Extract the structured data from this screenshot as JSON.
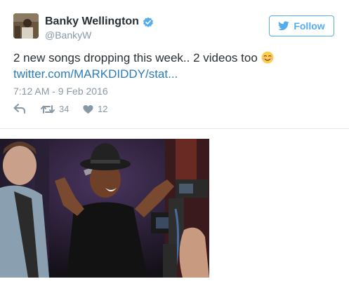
{
  "author": {
    "name": "Banky Wellington",
    "handle": "@BankyW"
  },
  "follow": {
    "label": "Follow"
  },
  "tweet": {
    "text": "2 new songs dropping this week.. 2 videos too",
    "emoji": "relaxed-face-emoji",
    "link": "twitter.com/MARKDIDDY/stat...",
    "timestamp": "7:12 AM - 9 Feb 2016"
  },
  "actions": {
    "retweets": "34",
    "likes": "12"
  },
  "colors": {
    "brand": "#55acee",
    "link": "#2b7bb9",
    "muted": "#8899a6",
    "text": "#292f33"
  }
}
